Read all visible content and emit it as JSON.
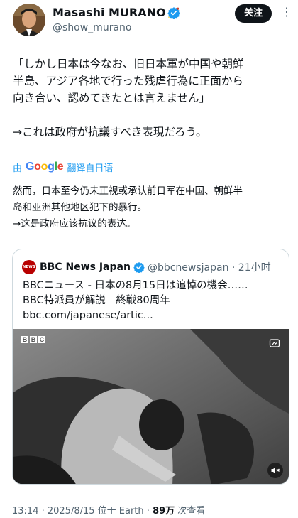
{
  "author": {
    "name": "Masashi MURANO",
    "emoji_icon": "rocket-icon",
    "handle": "@show_murano",
    "verified_color": "#1d9bf0"
  },
  "follow_label": "关注",
  "more_label": "⋮",
  "post": {
    "lines": [
      "「しかし日本は今なお、旧日本軍が中国や朝鮮",
      "半島、アジア各地で行った残虐行為に正面から",
      "向き合い、認めてきたとは言えません」",
      "→これは政府が抗議すべき表現だろう。"
    ]
  },
  "translate": {
    "prefix": "由",
    "brand": "Google",
    "action": "翻译自日语"
  },
  "translation": {
    "lines": [
      "然而，日本至今仍未正视或承认前日军在中国、朝鲜半",
      "岛和亚洲其他地区犯下的暴行。",
      "→这是政府应该抗议的表达。"
    ]
  },
  "quote": {
    "logo_text": "NEWS",
    "name": "BBC News Japan",
    "handle_time": "@bbcnewsjapan · 21小时",
    "lines": [
      "BBCニュース - 日本の8月15日は追悼の機会……",
      "BBC特派員が解説　終戦80周年",
      "bbc.com/japanese/artic..."
    ],
    "media_brand": "BBC"
  },
  "meta": {
    "time": "13:14 · 2025/8/15 位于 Earth ·",
    "views": "89万",
    "views_label": "次查看"
  },
  "colors": {
    "accent": "#1d9bf0",
    "text": "#0f1419",
    "muted": "#536471",
    "bbc_red": "#b80000"
  }
}
